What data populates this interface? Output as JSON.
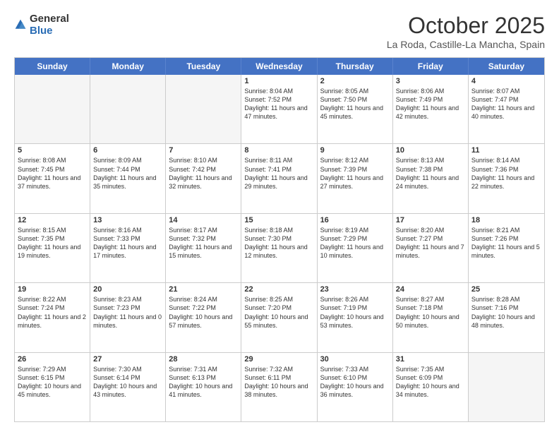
{
  "header": {
    "logo_general": "General",
    "logo_blue": "Blue",
    "month_title": "October 2025",
    "location": "La Roda, Castille-La Mancha, Spain"
  },
  "weekdays": [
    "Sunday",
    "Monday",
    "Tuesday",
    "Wednesday",
    "Thursday",
    "Friday",
    "Saturday"
  ],
  "rows": [
    [
      {
        "day": "",
        "text": ""
      },
      {
        "day": "",
        "text": ""
      },
      {
        "day": "",
        "text": ""
      },
      {
        "day": "1",
        "text": "Sunrise: 8:04 AM\nSunset: 7:52 PM\nDaylight: 11 hours and 47 minutes."
      },
      {
        "day": "2",
        "text": "Sunrise: 8:05 AM\nSunset: 7:50 PM\nDaylight: 11 hours and 45 minutes."
      },
      {
        "day": "3",
        "text": "Sunrise: 8:06 AM\nSunset: 7:49 PM\nDaylight: 11 hours and 42 minutes."
      },
      {
        "day": "4",
        "text": "Sunrise: 8:07 AM\nSunset: 7:47 PM\nDaylight: 11 hours and 40 minutes."
      }
    ],
    [
      {
        "day": "5",
        "text": "Sunrise: 8:08 AM\nSunset: 7:45 PM\nDaylight: 11 hours and 37 minutes."
      },
      {
        "day": "6",
        "text": "Sunrise: 8:09 AM\nSunset: 7:44 PM\nDaylight: 11 hours and 35 minutes."
      },
      {
        "day": "7",
        "text": "Sunrise: 8:10 AM\nSunset: 7:42 PM\nDaylight: 11 hours and 32 minutes."
      },
      {
        "day": "8",
        "text": "Sunrise: 8:11 AM\nSunset: 7:41 PM\nDaylight: 11 hours and 29 minutes."
      },
      {
        "day": "9",
        "text": "Sunrise: 8:12 AM\nSunset: 7:39 PM\nDaylight: 11 hours and 27 minutes."
      },
      {
        "day": "10",
        "text": "Sunrise: 8:13 AM\nSunset: 7:38 PM\nDaylight: 11 hours and 24 minutes."
      },
      {
        "day": "11",
        "text": "Sunrise: 8:14 AM\nSunset: 7:36 PM\nDaylight: 11 hours and 22 minutes."
      }
    ],
    [
      {
        "day": "12",
        "text": "Sunrise: 8:15 AM\nSunset: 7:35 PM\nDaylight: 11 hours and 19 minutes."
      },
      {
        "day": "13",
        "text": "Sunrise: 8:16 AM\nSunset: 7:33 PM\nDaylight: 11 hours and 17 minutes."
      },
      {
        "day": "14",
        "text": "Sunrise: 8:17 AM\nSunset: 7:32 PM\nDaylight: 11 hours and 15 minutes."
      },
      {
        "day": "15",
        "text": "Sunrise: 8:18 AM\nSunset: 7:30 PM\nDaylight: 11 hours and 12 minutes."
      },
      {
        "day": "16",
        "text": "Sunrise: 8:19 AM\nSunset: 7:29 PM\nDaylight: 11 hours and 10 minutes."
      },
      {
        "day": "17",
        "text": "Sunrise: 8:20 AM\nSunset: 7:27 PM\nDaylight: 11 hours and 7 minutes."
      },
      {
        "day": "18",
        "text": "Sunrise: 8:21 AM\nSunset: 7:26 PM\nDaylight: 11 hours and 5 minutes."
      }
    ],
    [
      {
        "day": "19",
        "text": "Sunrise: 8:22 AM\nSunset: 7:24 PM\nDaylight: 11 hours and 2 minutes."
      },
      {
        "day": "20",
        "text": "Sunrise: 8:23 AM\nSunset: 7:23 PM\nDaylight: 11 hours and 0 minutes."
      },
      {
        "day": "21",
        "text": "Sunrise: 8:24 AM\nSunset: 7:22 PM\nDaylight: 10 hours and 57 minutes."
      },
      {
        "day": "22",
        "text": "Sunrise: 8:25 AM\nSunset: 7:20 PM\nDaylight: 10 hours and 55 minutes."
      },
      {
        "day": "23",
        "text": "Sunrise: 8:26 AM\nSunset: 7:19 PM\nDaylight: 10 hours and 53 minutes."
      },
      {
        "day": "24",
        "text": "Sunrise: 8:27 AM\nSunset: 7:18 PM\nDaylight: 10 hours and 50 minutes."
      },
      {
        "day": "25",
        "text": "Sunrise: 8:28 AM\nSunset: 7:16 PM\nDaylight: 10 hours and 48 minutes."
      }
    ],
    [
      {
        "day": "26",
        "text": "Sunrise: 7:29 AM\nSunset: 6:15 PM\nDaylight: 10 hours and 45 minutes."
      },
      {
        "day": "27",
        "text": "Sunrise: 7:30 AM\nSunset: 6:14 PM\nDaylight: 10 hours and 43 minutes."
      },
      {
        "day": "28",
        "text": "Sunrise: 7:31 AM\nSunset: 6:13 PM\nDaylight: 10 hours and 41 minutes."
      },
      {
        "day": "29",
        "text": "Sunrise: 7:32 AM\nSunset: 6:11 PM\nDaylight: 10 hours and 38 minutes."
      },
      {
        "day": "30",
        "text": "Sunrise: 7:33 AM\nSunset: 6:10 PM\nDaylight: 10 hours and 36 minutes."
      },
      {
        "day": "31",
        "text": "Sunrise: 7:35 AM\nSunset: 6:09 PM\nDaylight: 10 hours and 34 minutes."
      },
      {
        "day": "",
        "text": ""
      }
    ]
  ]
}
